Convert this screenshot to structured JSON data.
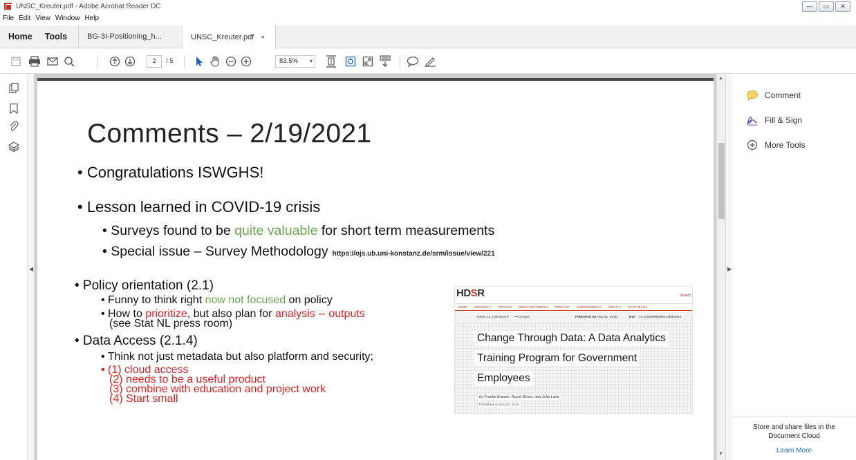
{
  "window": {
    "title": "UNSC_Kreuter.pdf - Adobe Acrobat Reader DC",
    "controls": [
      "—",
      "▭",
      "✕"
    ]
  },
  "menu": [
    "File",
    "Edit",
    "View",
    "Window",
    "Help"
  ],
  "tabs": {
    "home": "Home",
    "tools": "Tools",
    "docs": [
      {
        "label": "BG-3I-Positioning_h...",
        "active": false
      },
      {
        "label": "UNSC_Kreuter.pdf",
        "active": true
      }
    ],
    "close": "×"
  },
  "toolbar": {
    "page_current": "2",
    "page_total": "/ 5",
    "zoom": "83.5%",
    "zoom_caret": "▾"
  },
  "slide": {
    "title": "Comments – 2/19/2021",
    "bullet1": "• Congratulations ISWGHS!",
    "bullet2": "• Lesson learned in COVID-19 crisis",
    "sub1_pre": "• Surveys found to be ",
    "sub1_green": "quite valuable",
    "sub1_post": " for short term measurements",
    "sub2": "• Special issue – Survey Methodology",
    "sub2_url": "https://ojs.ub.uni-konstanz.de/srm/issue/view/221",
    "policy": "• Policy orientation (2.1)",
    "policy_a_pre": "• Funny to think right ",
    "policy_a_green": "now not focused",
    "policy_a_post": " on policy",
    "policy_b_pre": "• How to ",
    "policy_b_red1": "prioritize",
    "policy_b_mid": ", but also plan for ",
    "policy_b_red2": "analysis -- outputs",
    "policy_b_line2": "(see Stat NL press room)",
    "access": "• Data Access (2.1.4)",
    "access_a": "• Think not just metadata but also platform and security;",
    "access_items": [
      "• (1) cloud access",
      "(2) needs to be a useful product",
      "(3) combine with education and project work",
      "(4) Start small"
    ]
  },
  "hdsr": {
    "logo_a": "HD",
    "logo_b": "S",
    "logo_c": "R",
    "search": "Search",
    "nav": [
      "HOME",
      "JOURNAL ▾",
      "TOPICS ▾",
      "MEDIA FEATURES ▾",
      "PODCAST",
      "SUBMISSIONS ▾",
      "ABOUT ▾",
      "MASTHEAD ▾"
    ],
    "issue": "Issue 1.2, Fall 2019 ▾",
    "more": "••• 3 more",
    "published_label": "Published on",
    "published_date": "Nov 01, 2019",
    "doi_label": "DOI",
    "doi": "10.1162/99608f92.ed353ae3",
    "title_lines": [
      "Change Through Data: A Data Analytics",
      "Training Program for Government",
      "Employees"
    ],
    "authors": "by Frauke Kreuter, Rayid Ghani, and Julia Lane",
    "pub_line": "Published on   Nov 01, 2019"
  },
  "right_panel": {
    "items": [
      {
        "label": "Comment",
        "icon": "comment-icon"
      },
      {
        "label": "Fill & Sign",
        "icon": "fill-sign-icon"
      },
      {
        "label": "More Tools",
        "icon": "more-tools-icon"
      }
    ],
    "footer_line1": "Store and share files in the",
    "footer_line2": "Document Cloud",
    "learn_more": "Learn More"
  },
  "colors": {
    "accent_red": "#e02020",
    "accent_green": "#6aa84f",
    "link_blue": "#1f6fd1"
  }
}
